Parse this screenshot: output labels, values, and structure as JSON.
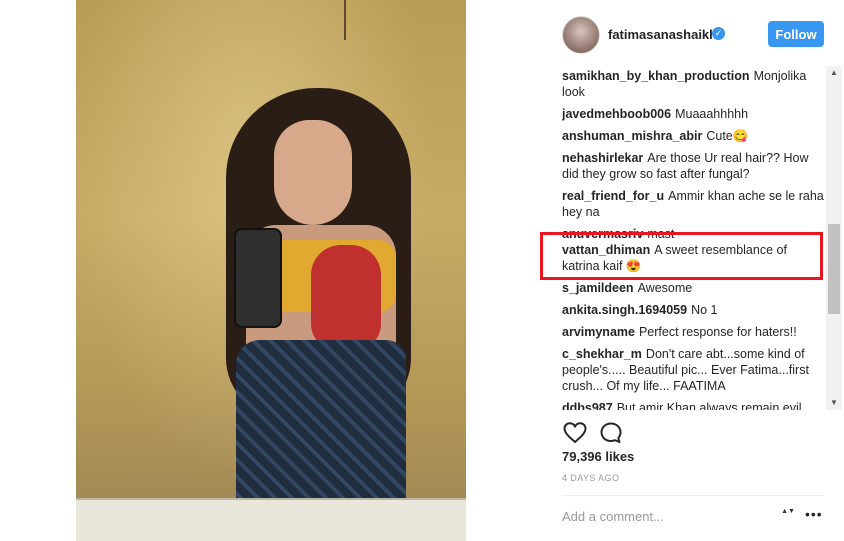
{
  "header": {
    "username": "fatimasanashaikh",
    "verified_glyph": "✓",
    "follow_label": "Follow"
  },
  "comments": [
    {
      "user": "samikhan_by_khan_production",
      "text": "Monjolika look"
    },
    {
      "user": "javedmehboob006",
      "text": "Muaaahhhhh"
    },
    {
      "user": "anshuman_mishra_abir",
      "text": "Cute😋"
    },
    {
      "user": "nehashirlekar",
      "text": "Are those Ur real hair?? How did they grow so fast after fungal?"
    },
    {
      "user": "real_friend_for_u",
      "text": "Ammir khan ache se le raha hey na"
    },
    {
      "user": "anuvermasriv",
      "text": "mast"
    },
    {
      "user": "vattan_dhiman",
      "text": "A sweet resemblance of katrina kaif 😍"
    },
    {
      "user": "s_jamildeen",
      "text": "Awesome"
    },
    {
      "user": "ankita.singh.1694059",
      "text": "No 1"
    },
    {
      "user": "arvimyname",
      "text": "Perfect response for haters!!"
    },
    {
      "user": "c_shekhar_m",
      "text": "Don't care abt...some kind of people's..... Beautiful pic... Ever Fatima...first crush... Of my life... FAATIMA"
    },
    {
      "user": "ddbs987",
      "text": "But amir Khan always remain evil"
    }
  ],
  "scrollbar": {
    "up": "▲",
    "down": "▼"
  },
  "actions": {
    "like_icon": "heart-icon",
    "comment_icon": "comment-icon"
  },
  "likes": "79,396 likes",
  "timestamp": "4 DAYS AGO",
  "comment_box": {
    "placeholder": "Add a comment...",
    "spinner": "▲▼",
    "more": "•••"
  },
  "colors": {
    "accent": "#3897f0",
    "highlight": "#e8171f"
  }
}
